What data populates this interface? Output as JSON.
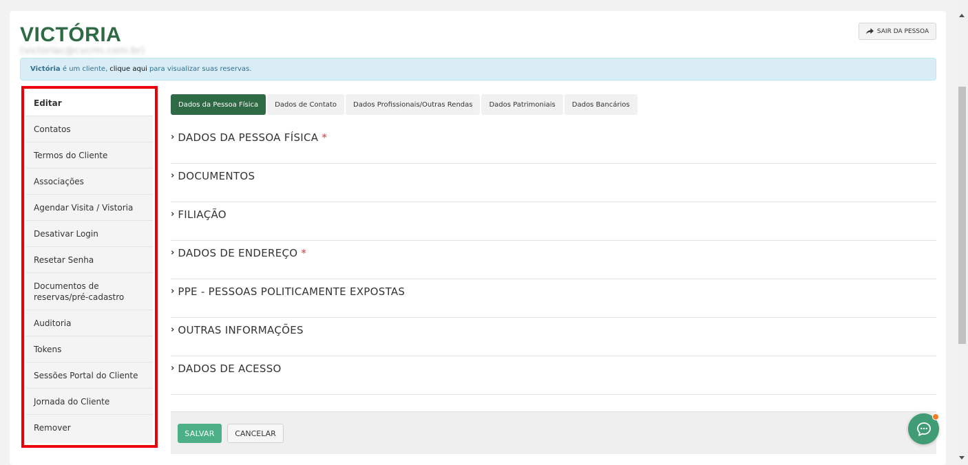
{
  "header": {
    "title": "VICTÓRIA",
    "email": "(victoriac@cvcrm.com.br)",
    "exit_button": "SAIR DA PESSOA",
    "exit_icon": "share-arrow-icon"
  },
  "notice": {
    "name": "Victória",
    "text1": "é um cliente,",
    "link": "clique aqui",
    "text2": "para visualizar suas reservas."
  },
  "sidebar": {
    "items": [
      {
        "label": "Editar"
      },
      {
        "label": "Contatos"
      },
      {
        "label": "Termos do Cliente"
      },
      {
        "label": "Associações"
      },
      {
        "label": "Agendar Visita / Vistoria"
      },
      {
        "label": "Desativar Login"
      },
      {
        "label": "Resetar Senha"
      },
      {
        "label": "Documentos de reservas/pré-cadastro"
      },
      {
        "label": "Auditoria"
      },
      {
        "label": "Tokens"
      },
      {
        "label": "Sessões Portal do Cliente"
      },
      {
        "label": "Jornada do Cliente"
      },
      {
        "label": "Remover"
      }
    ],
    "highlight_color": "#e8000a"
  },
  "tabs": [
    {
      "label": "Dados da Pessoa Física"
    },
    {
      "label": "Dados de Contato"
    },
    {
      "label": "Dados Profissionais/Outras Rendas"
    },
    {
      "label": "Dados Patrimoniais"
    },
    {
      "label": "Dados Bancários"
    }
  ],
  "sections": [
    {
      "label": "DADOS DA PESSOA FÍSICA",
      "required": "*"
    },
    {
      "label": "DOCUMENTOS",
      "required": ""
    },
    {
      "label": "FILIAÇÃO",
      "required": ""
    },
    {
      "label": "DADOS DE ENDEREÇO",
      "required": "*"
    },
    {
      "label": "PPE - PESSOAS POLITICAMENTE EXPOSTAS",
      "required": ""
    },
    {
      "label": "OUTRAS INFORMAÇÕES",
      "required": ""
    },
    {
      "label": "DADOS DE ACESSO",
      "required": ""
    }
  ],
  "footer": {
    "save": "SALVAR",
    "cancel": "CANCELAR"
  },
  "colors": {
    "brand": "#2e6b45",
    "save": "#4caf86",
    "chat": "#3f9c75",
    "notification": "#f47b20"
  }
}
